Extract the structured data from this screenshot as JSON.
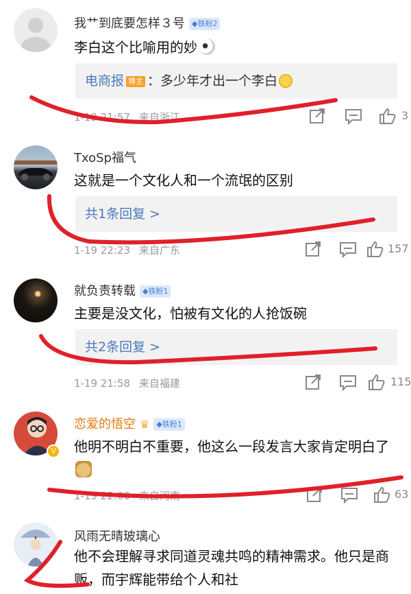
{
  "comments": [
    {
      "user": "我艹到底要怎样３号",
      "badge": "◆铁粉2",
      "text": "李白这个比喻用的妙",
      "reply": {
        "author": "电商报",
        "author_tag": "博主",
        "text": "：多少年才出一个李白"
      },
      "time": "1-19 21:57",
      "location": "来自浙江",
      "likes": "3"
    },
    {
      "user": "TxoSp福气",
      "text": "这就是一个文化人和一个流氓的区别",
      "reply_more": "共1条回复 >",
      "time": "1-19 22:23",
      "location": "来自广东",
      "likes": "157"
    },
    {
      "user": "就负责转载",
      "badge": "◆铁粉1",
      "text": "主要是没文化，怕被有文化的人抢饭碗",
      "reply_more": "共2条回复 >",
      "time": "1-19 21:58",
      "location": "来自福建",
      "likes": "115"
    },
    {
      "user": "恋爱的悟空",
      "badge": "◆铁粉1",
      "text": "他明不明白不重要，他这么一段发言大家肯定明白了",
      "time": "1-19 22:00",
      "location": "来自河南",
      "likes": "63"
    },
    {
      "user": "风雨无晴玻璃心",
      "text": "他不会理解寻求同道灵魂共鸣的精神需求。他只是商贩，而宇辉能带给个人和社"
    }
  ],
  "colors": {
    "link": "#4c78bc",
    "vip_name": "#e4790f",
    "annotation_red": "#e0202a"
  },
  "icons": [
    "share-icon",
    "comment-icon",
    "like-icon"
  ]
}
